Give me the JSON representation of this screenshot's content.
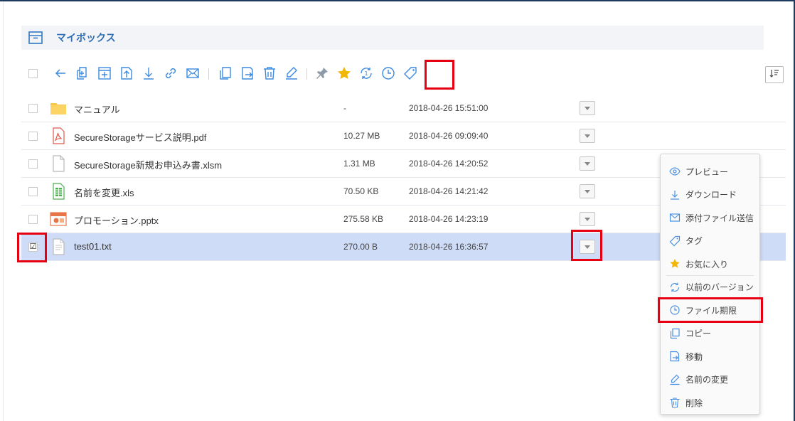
{
  "header": {
    "title": "マイボックス",
    "icon": "box-icon"
  },
  "toolbar": {
    "icons": [
      "checkbox",
      "back-arrow-icon",
      "new-file-icon",
      "new-folder-icon",
      "upload-icon",
      "download-icon",
      "link-icon",
      "mail-icon",
      "copy-icon",
      "move-icon",
      "delete-icon",
      "rename-icon",
      "pin-icon",
      "star-icon",
      "version-history-icon",
      "clock-icon",
      "tag-icon",
      "sort-icon"
    ],
    "highlighted": "clock-icon"
  },
  "files": [
    {
      "name": "マニュアル",
      "size": "-",
      "date": "2018-04-26 15:51:00",
      "type": "folder",
      "selected": false
    },
    {
      "name": "SecureStorageサービス説明.pdf",
      "size": "10.27 MB",
      "date": "2018-04-26 09:09:40",
      "type": "pdf",
      "selected": false
    },
    {
      "name": "SecureStorage新規お申込み書.xlsm",
      "size": "1.31 MB",
      "date": "2018-04-26 14:20:52",
      "type": "generic",
      "selected": false
    },
    {
      "name": "名前を変更.xls",
      "size": "70.50 KB",
      "date": "2018-04-26 14:21:42",
      "type": "excel",
      "selected": false
    },
    {
      "name": "プロモーション.pptx",
      "size": "275.58 KB",
      "date": "2018-04-26 14:23:19",
      "type": "powerpoint",
      "selected": false
    },
    {
      "name": "test01.txt",
      "size": "270.00 B",
      "date": "2018-04-26 16:36:57",
      "type": "text",
      "selected": true
    }
  ],
  "selected_checkbox_mark": "☑",
  "context_menu": {
    "items": [
      {
        "label": "プレビュー",
        "icon": "eye-icon"
      },
      {
        "label": "ダウンロード",
        "icon": "download-icon"
      },
      {
        "label": "添付ファイル送信",
        "icon": "mail-icon"
      },
      {
        "label": "タグ",
        "icon": "tag-icon"
      },
      {
        "label": "お気に入り",
        "icon": "star-icon"
      },
      {
        "label": "以前のバージョン",
        "icon": "version-history-icon"
      },
      {
        "label": "ファイル期限",
        "icon": "clock-icon"
      },
      {
        "label": "コピー",
        "icon": "copy-icon"
      },
      {
        "label": "移動",
        "icon": "move-icon"
      },
      {
        "label": "名前の変更",
        "icon": "rename-icon"
      },
      {
        "label": "削除",
        "icon": "delete-icon"
      }
    ],
    "highlighted": "ファイル期限"
  },
  "colors": {
    "accent": "#3b8be0",
    "highlight_box": "#e60012",
    "selected_row": "#cfdcf7",
    "header_bg": "#f2f4f7",
    "star": "#f2b705"
  }
}
